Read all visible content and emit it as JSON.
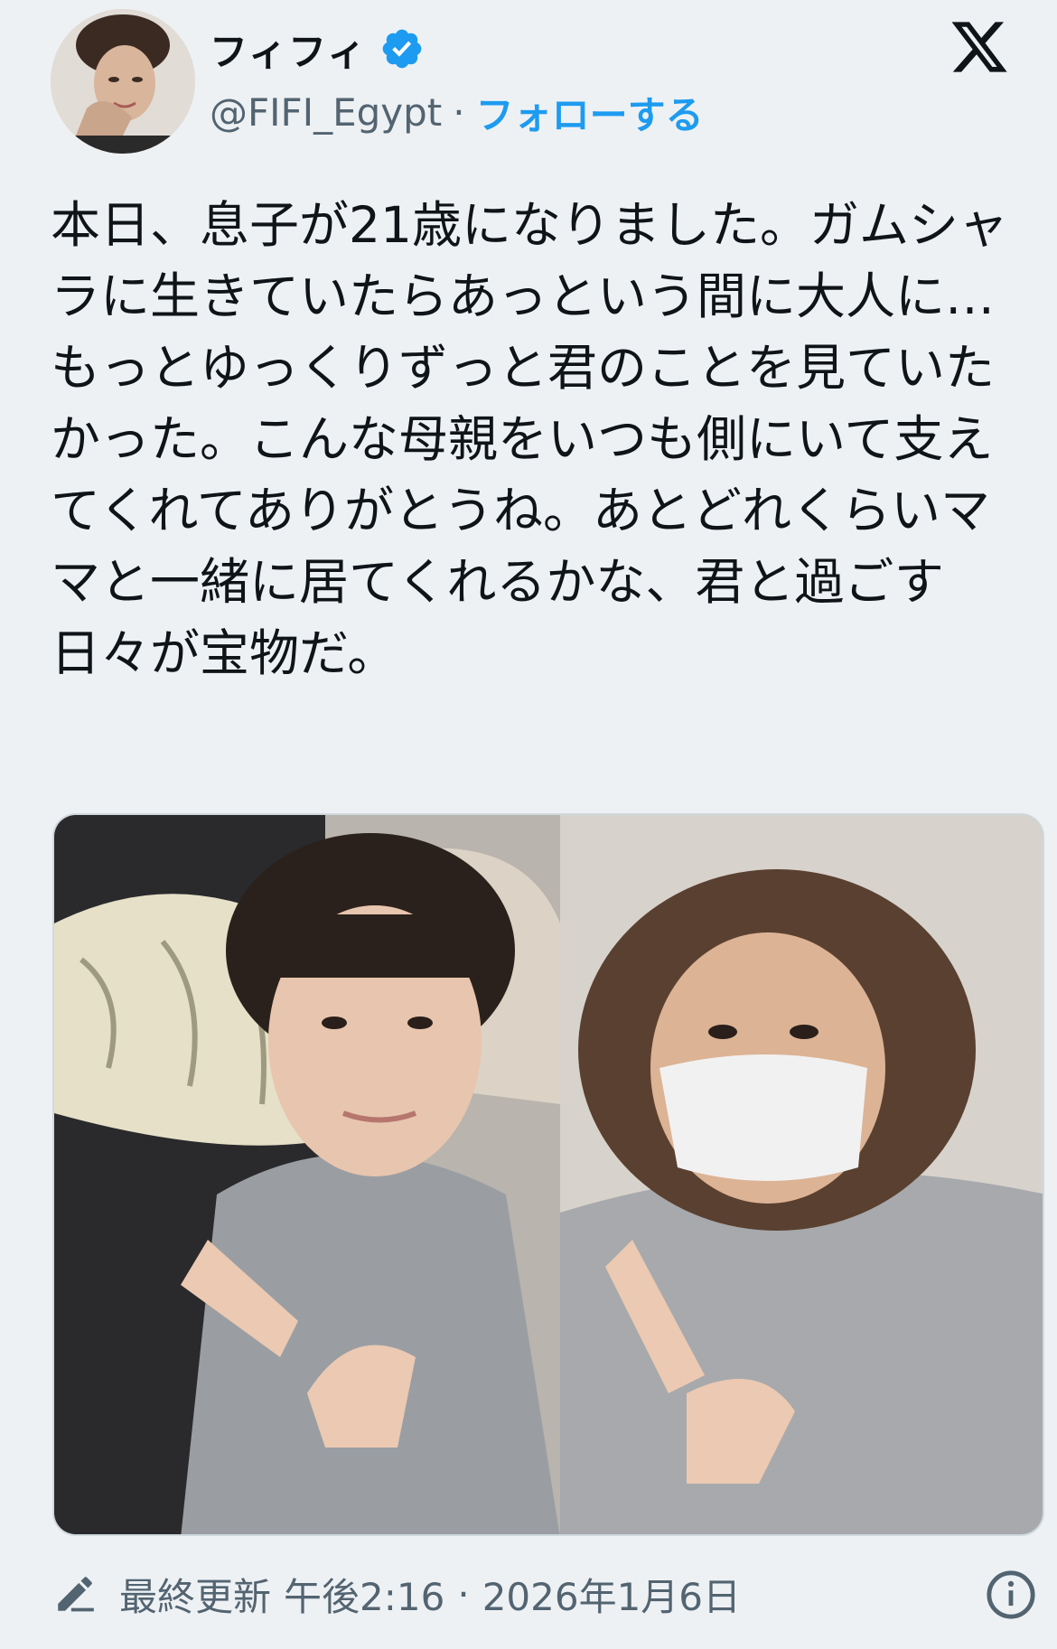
{
  "header": {
    "display_name": "フィフィ",
    "handle": "@FIFI_Egypt",
    "separator": "·",
    "follow_label": "フォローする",
    "verified_icon": "verified-badge-icon",
    "brand_icon": "x-logo-icon"
  },
  "tweet": {
    "text": "本日、息子が21歳になりました。ガムシャラに生きていたらあっという間に大人に…もっとゆっくりずっと君のことを見ていたかった。こんな母親をいつも側にいて支えてくれてありがとうね。あとどれくらいママと一緒に居てくれるかな、君と過ごす日々が宝物だ。"
  },
  "footer": {
    "edited_label": "最終更新",
    "time": "午後2:16",
    "separator": "·",
    "date": "2026年1月6日",
    "edit_icon": "pencil-icon",
    "info_icon": "info-icon"
  },
  "colors": {
    "accent": "#1d9bf0",
    "text": "#0f1419",
    "secondary": "#536471",
    "background": "#eef1f4"
  }
}
